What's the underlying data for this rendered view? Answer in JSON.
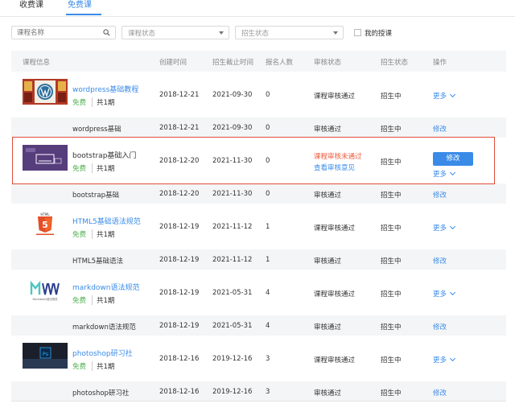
{
  "tabs": [
    {
      "label": "收费课"
    },
    {
      "label": "免费课"
    }
  ],
  "filters": {
    "search_placeholder": "课程名称",
    "status_placeholder": "课程状态",
    "enroll_placeholder": "招生状态",
    "my_teaching_label": "我的授课"
  },
  "headers": [
    "课程信息",
    "创建时间",
    "招生截止时间",
    "报名人数",
    "审核状态",
    "招生状态",
    "操作"
  ],
  "rows": [
    {
      "title": "wordpress基础教程",
      "free": "免费",
      "term": "共1期",
      "created": "2018-12-21",
      "deadline": "2021-09-30",
      "count": "0",
      "audit": "课程审核通过",
      "audit2": "",
      "enroll": "招生中",
      "action": "更多",
      "action_btn": "",
      "sub": {
        "name": "wordpress基础",
        "created": "2018-12-21",
        "deadline": "2021-09-30",
        "count": "0",
        "audit": "审核通过",
        "enroll": "招生中",
        "action": "修改"
      }
    },
    {
      "title": "bootstrap基础入门",
      "free": "免费",
      "term": "共1期",
      "created": "2018-12-20",
      "deadline": "2021-11-30",
      "count": "0",
      "audit": "课程审核未通过",
      "audit2": "查看审核意见",
      "enroll": "招生中",
      "action": "更多",
      "action_btn": "修改",
      "sub": {
        "name": "bootstrap基础",
        "created": "2018-12-20",
        "deadline": "2021-11-30",
        "count": "0",
        "audit": "审核通过",
        "enroll": "招生中",
        "action": "修改"
      }
    },
    {
      "title": "HTML5基础语法规范",
      "free": "免费",
      "term": "共1期",
      "created": "2018-12-19",
      "deadline": "2021-11-12",
      "count": "1",
      "audit": "课程审核通过",
      "audit2": "",
      "enroll": "招生中",
      "action": "更多",
      "action_btn": "",
      "sub": {
        "name": "HTML5基础语法",
        "created": "2018-12-19",
        "deadline": "2021-11-12",
        "count": "1",
        "audit": "审核通过",
        "enroll": "招生中",
        "action": "修改"
      }
    },
    {
      "title": "markdown语法规范",
      "free": "免费",
      "term": "共1期",
      "created": "2018-12-19",
      "deadline": "2021-05-31",
      "count": "4",
      "audit": "课程审核通过",
      "audit2": "",
      "enroll": "招生中",
      "action": "更多",
      "action_btn": "",
      "sub": {
        "name": "markdown语法规范",
        "created": "2018-12-19",
        "deadline": "2021-05-31",
        "count": "4",
        "audit": "审核通过",
        "enroll": "招生中",
        "action": "修改"
      }
    },
    {
      "title": "photoshop研习社",
      "free": "免费",
      "term": "共1期",
      "created": "2018-12-16",
      "deadline": "2019-12-16",
      "count": "3",
      "audit": "课程审核通过",
      "audit2": "",
      "enroll": "招生中",
      "action": "更多",
      "action_btn": "",
      "sub": {
        "name": "photoshop研习社",
        "created": "2018-12-16",
        "deadline": "2019-12-16",
        "count": "3",
        "audit": "审核通过",
        "enroll": "招生中",
        "action": "修改"
      }
    }
  ],
  "thumbs": {
    "html5_text": "HTML",
    "html5_num": "5",
    "markdown_caption": "Markdown语法规范",
    "ps_text": "Ps"
  },
  "colors": {
    "accent": "#3a8be8",
    "free": "#52b252",
    "error": "#f05a3c",
    "highlight": "#e24d3b"
  }
}
